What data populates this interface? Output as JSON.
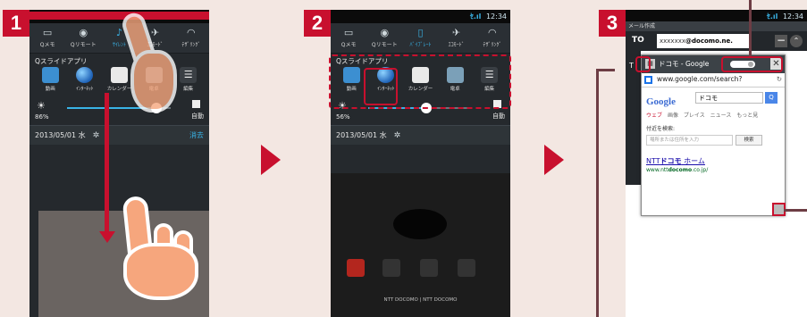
{
  "steps": [
    {
      "number": "1"
    },
    {
      "number": "2"
    },
    {
      "number": "3"
    }
  ],
  "status_bar": {
    "signal": "ｾ.ıl",
    "time": "12:34"
  },
  "toggles": [
    {
      "label": "Qメモ",
      "icon": "qmemo-icon"
    },
    {
      "label": "Qリモート",
      "icon": "qremote-icon"
    },
    {
      "label": "ｻｲﾚﾝﾄ",
      "icon": "silent-icon"
    },
    {
      "label": "ﾊﾞｲﾌﾞﾚｰﾄ",
      "icon": "vibrate-icon"
    },
    {
      "label": "ｴｺﾓｰﾄﾞ",
      "icon": "eco-icon"
    },
    {
      "label": "ﾃｻﾞﾘﾝｸﾞ",
      "icon": "tethering-icon"
    }
  ],
  "toggles_p2": [
    {
      "label": "Qメモ"
    },
    {
      "label": "Qリモート"
    },
    {
      "label": "ﾊﾞｲﾌﾞﾚｰﾄ"
    },
    {
      "label": "ｴｺﾓｰﾄﾞ"
    },
    {
      "label": "ﾃｻﾞﾘﾝｸﾞ"
    }
  ],
  "qslide": {
    "title": "Qスライドアプリ",
    "apps_p1": [
      "動画",
      "ｲﾝﾀｰﾈｯﾄ",
      "カレンダー",
      "電卓",
      "編集"
    ],
    "apps_p2": [
      "動画",
      "ｲﾝﾀｰﾈｯﾄ",
      "カレンダー",
      "電卓",
      "編集"
    ]
  },
  "brightness": {
    "p1_percent": "86%",
    "p2_percent": "56%",
    "p1_level": 0.86,
    "p2_level": 0.56,
    "auto_label": "自動"
  },
  "date_bar": {
    "date": "2013/05/01 水",
    "clear": "消去"
  },
  "home": {
    "carrier": "NTT DOCOMO | NTT DOCOMO"
  },
  "compose": {
    "title": "メール作成",
    "to_label": "TO",
    "address_prefix": "xxxxxxx",
    "address_domain": "@docomo.ne.",
    "left_t": "T"
  },
  "browser": {
    "tab_title": "ドコモ - Google",
    "url": "www.google.com/search?",
    "logo": "Google",
    "query": "ドコモ",
    "search_btn": "Q",
    "tabs": [
      "ウェブ",
      "画像",
      "プレイス",
      "ニュース",
      "もっと見"
    ],
    "nearby_label": "付近を検索:",
    "location_placeholder": "場所または住所を入力",
    "location_btn": "検索",
    "result_title_a": "NTT",
    "result_title_b": "ドコモ",
    "result_title_c": " ホーム",
    "result_url_a": "www.ntt",
    "result_url_b": "docomo",
    "result_url_c": ".co.jp/"
  },
  "colors": {
    "accent": "#c8102e",
    "panel": "#25292d",
    "highlight": "#39b3e6",
    "background": "#f3e7e2"
  }
}
